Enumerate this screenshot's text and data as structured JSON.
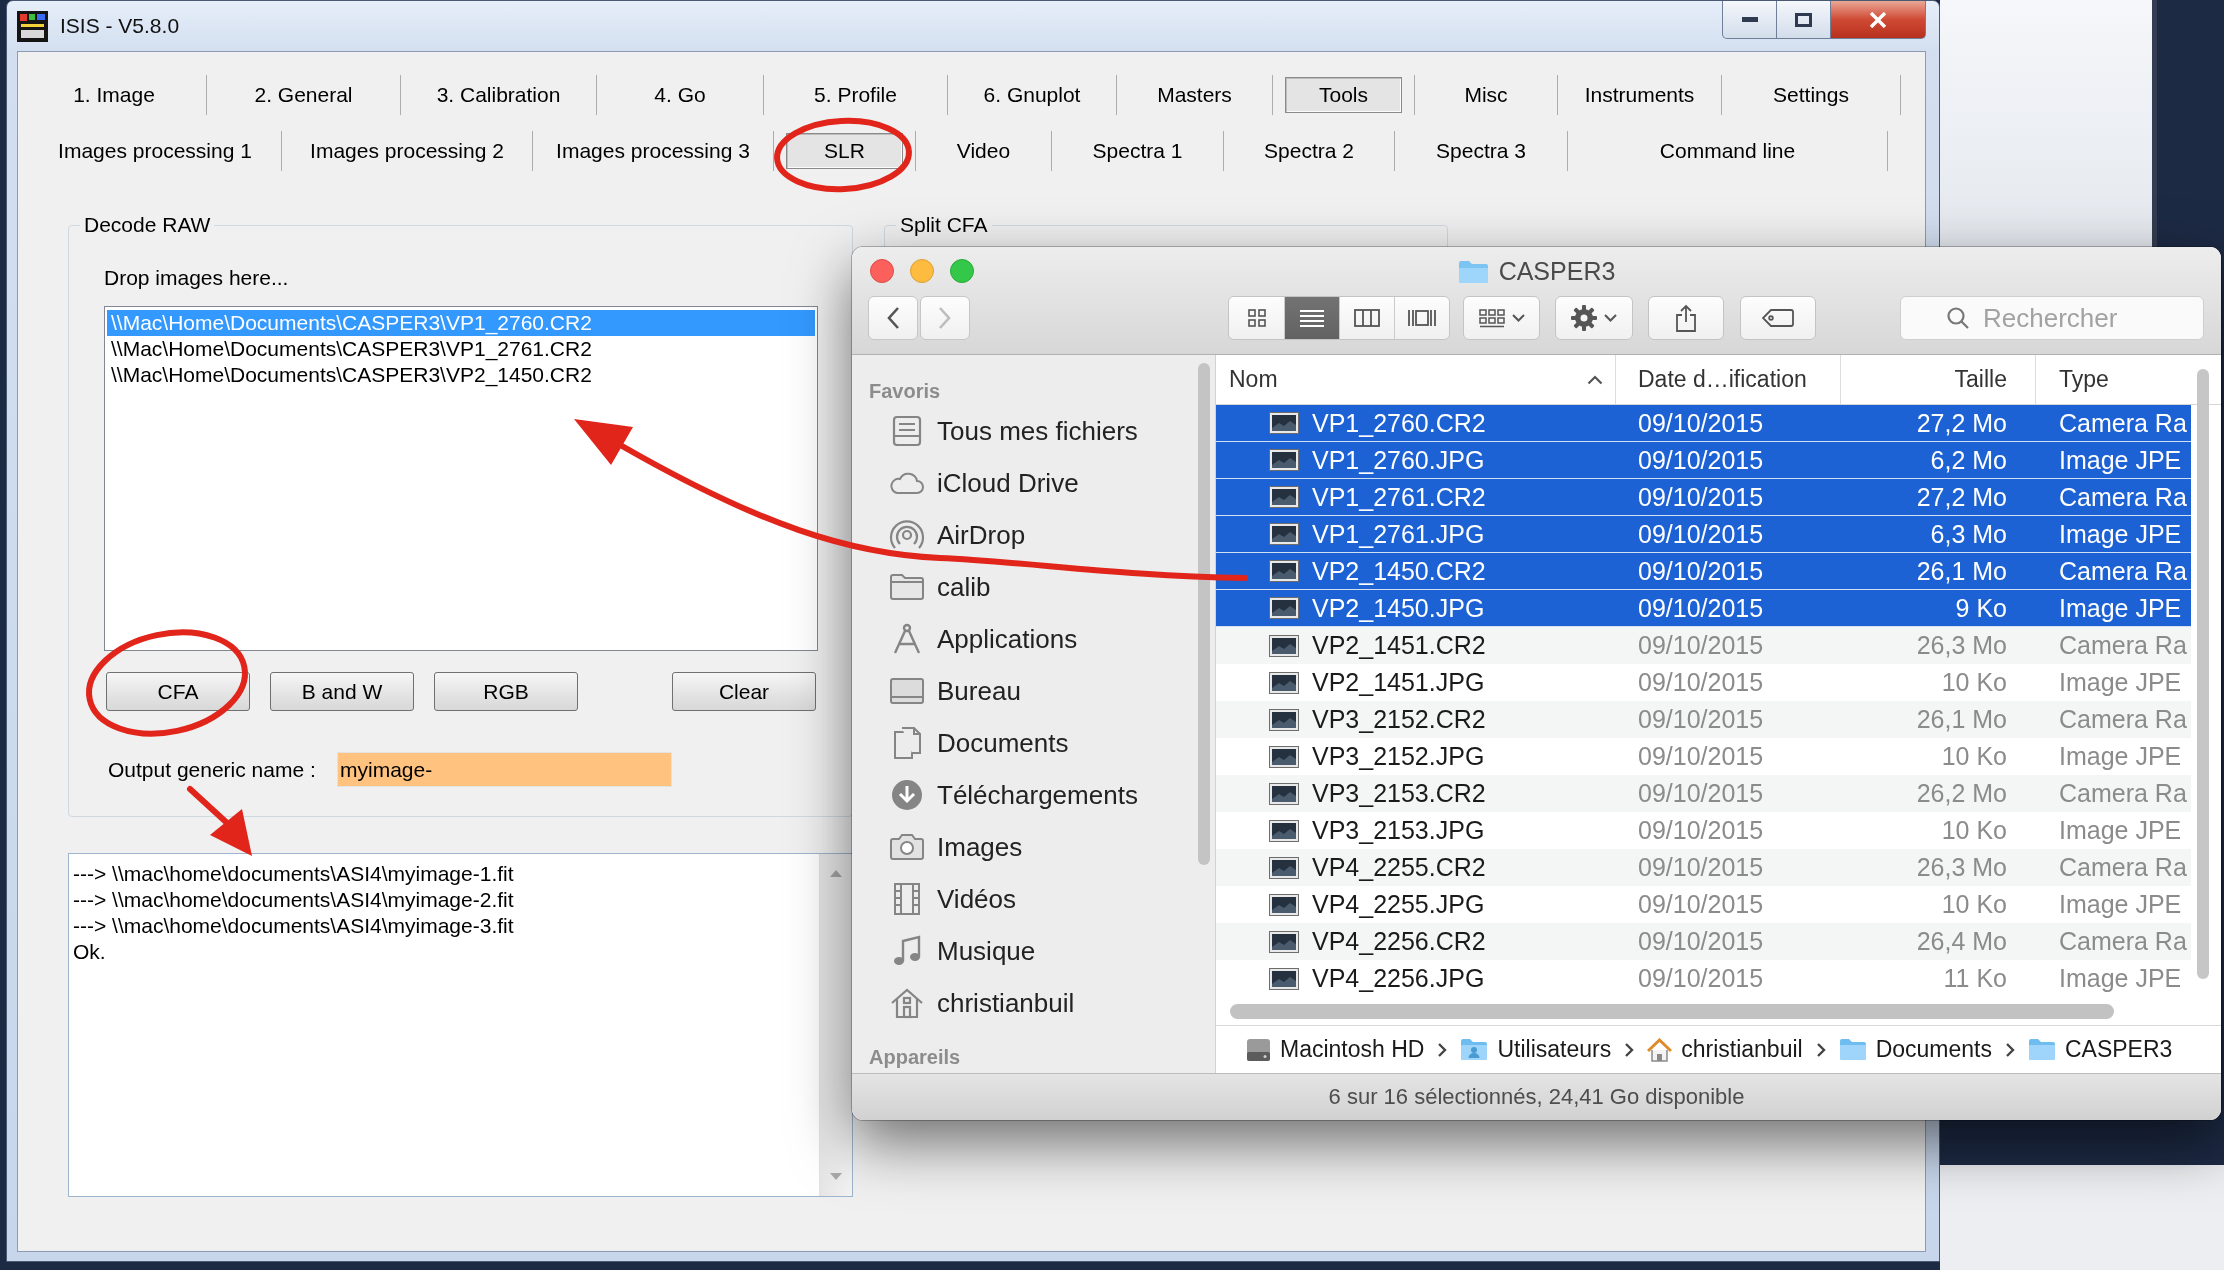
{
  "isis_window": {
    "title": "ISIS - V5.8.0",
    "tabs_row_1": [
      {
        "label": "1. Image",
        "selected": false
      },
      {
        "label": "2. General",
        "selected": false
      },
      {
        "label": "3. Calibration",
        "selected": false
      },
      {
        "label": "4. Go",
        "selected": false
      },
      {
        "label": "5. Profile",
        "selected": false
      },
      {
        "label": "6. Gnuplot",
        "selected": false
      },
      {
        "label": "Masters",
        "selected": false
      },
      {
        "label": "Tools",
        "selected": true
      },
      {
        "label": "Misc",
        "selected": false
      },
      {
        "label": "Instruments",
        "selected": false
      },
      {
        "label": "Settings",
        "selected": false
      }
    ],
    "tabs_row_2": [
      {
        "label": "Images processing 1",
        "selected": false
      },
      {
        "label": "Images processing 2",
        "selected": false
      },
      {
        "label": "Images processing 3",
        "selected": false
      },
      {
        "label": "SLR",
        "selected": true
      },
      {
        "label": "Video",
        "selected": false
      },
      {
        "label": "Spectra 1",
        "selected": false
      },
      {
        "label": "Spectra 2",
        "selected": false
      },
      {
        "label": "Spectra 3",
        "selected": false
      },
      {
        "label": "Command line",
        "selected": false
      }
    ],
    "decode_raw": {
      "title": "Decode RAW",
      "drop_label": "Drop images here...",
      "files": [
        {
          "path": "\\\\Mac\\Home\\Documents\\CASPER3\\VP1_2760.CR2",
          "selected": true
        },
        {
          "path": "\\\\Mac\\Home\\Documents\\CASPER3\\VP1_2761.CR2",
          "selected": false
        },
        {
          "path": "\\\\Mac\\Home\\Documents\\CASPER3\\VP2_1450.CR2",
          "selected": false
        }
      ],
      "buttons": [
        "CFA",
        "B and W",
        "RGB",
        "Clear"
      ],
      "output_label": "Output generic name :",
      "output_name": {
        "value": "myimage-"
      }
    },
    "split_cfa": {
      "title": "Split CFA"
    },
    "log": [
      "---> \\\\mac\\home\\documents\\ASI4\\myimage-1.fit",
      "---> \\\\mac\\home\\documents\\ASI4\\myimage-2.fit",
      "---> \\\\mac\\home\\documents\\ASI4\\myimage-3.fit",
      "Ok."
    ]
  },
  "finder_window": {
    "title": "CASPER3",
    "toolbar": {
      "navigation": [
        {
          "disabled": false
        },
        {
          "disabled": true
        }
      ],
      "views": [
        {
          "selected": false
        },
        {
          "selected": true
        },
        {
          "selected": false
        },
        {
          "selected": false
        }
      ],
      "search": {
        "placeholder": "Rechercher"
      }
    },
    "sidebar": {
      "sections": [
        {
          "title": "Favoris",
          "items": [
            "Tous mes fichiers",
            "iCloud Drive",
            "AirDrop",
            "calib",
            "Applications",
            "Bureau",
            "Documents",
            "Téléchargements",
            "Images",
            "Vidéos",
            "Musique",
            "christianbuil"
          ]
        },
        {
          "title": "Appareils"
        }
      ]
    },
    "columns": [
      {
        "label": "Nom",
        "sorted": true
      },
      {
        "label": "Date d…ification",
        "sorted": false
      },
      {
        "label": "Taille",
        "sorted": false
      },
      {
        "label": "Type",
        "sorted": false
      }
    ],
    "rows": [
      {
        "name": "VP1_2760.CR2",
        "date": "09/10/2015",
        "size": "27,2 Mo",
        "type": "Camera Ra",
        "selected": true
      },
      {
        "name": "VP1_2760.JPG",
        "date": "09/10/2015",
        "size": "6,2 Mo",
        "type": "Image JPE",
        "selected": true
      },
      {
        "name": "VP1_2761.CR2",
        "date": "09/10/2015",
        "size": "27,2 Mo",
        "type": "Camera Ra",
        "selected": true
      },
      {
        "name": "VP1_2761.JPG",
        "date": "09/10/2015",
        "size": "6,3 Mo",
        "type": "Image JPE",
        "selected": true
      },
      {
        "name": "VP2_1450.CR2",
        "date": "09/10/2015",
        "size": "26,1 Mo",
        "type": "Camera Ra",
        "selected": true
      },
      {
        "name": "VP2_1450.JPG",
        "date": "09/10/2015",
        "size": "9 Ko",
        "type": "Image JPE",
        "selected": true
      },
      {
        "name": "VP2_1451.CR2",
        "date": "09/10/2015",
        "size": "26,3 Mo",
        "type": "Camera Ra",
        "selected": false
      },
      {
        "name": "VP2_1451.JPG",
        "date": "09/10/2015",
        "size": "10 Ko",
        "type": "Image JPE",
        "selected": false
      },
      {
        "name": "VP3_2152.CR2",
        "date": "09/10/2015",
        "size": "26,1 Mo",
        "type": "Camera Ra",
        "selected": false
      },
      {
        "name": "VP3_2152.JPG",
        "date": "09/10/2015",
        "size": "10 Ko",
        "type": "Image JPE",
        "selected": false
      },
      {
        "name": "VP3_2153.CR2",
        "date": "09/10/2015",
        "size": "26,2 Mo",
        "type": "Camera Ra",
        "selected": false
      },
      {
        "name": "VP3_2153.JPG",
        "date": "09/10/2015",
        "size": "10 Ko",
        "type": "Image JPE",
        "selected": false
      },
      {
        "name": "VP4_2255.CR2",
        "date": "09/10/2015",
        "size": "26,3 Mo",
        "type": "Camera Ra",
        "selected": false
      },
      {
        "name": "VP4_2255.JPG",
        "date": "09/10/2015",
        "size": "10 Ko",
        "type": "Image JPE",
        "selected": false
      },
      {
        "name": "VP4_2256.CR2",
        "date": "09/10/2015",
        "size": "26,4 Mo",
        "type": "Camera Ra",
        "selected": false
      },
      {
        "name": "VP4_2256.JPG",
        "date": "09/10/2015",
        "size": "11 Ko",
        "type": "Image JPE",
        "selected": false
      }
    ],
    "path": [
      "Macintosh HD",
      "Utilisateurs",
      "christianbuil",
      "Documents",
      "CASPER3"
    ],
    "status": "6 sur 16 sélectionnés, 24,41 Go disponible"
  },
  "annotations": [
    {
      "kind": "circle"
    },
    {
      "kind": "circle"
    },
    {
      "kind": "arrow"
    },
    {
      "kind": "arrow"
    }
  ]
}
